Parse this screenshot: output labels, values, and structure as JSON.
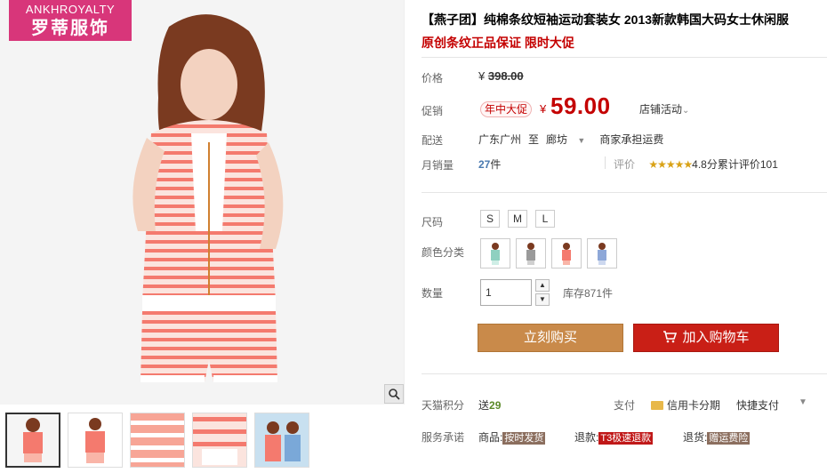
{
  "gallery": {
    "brand_en": "ANKHROYALTY",
    "brand_cn": "罗蒂服饰",
    "zoom_icon": "magnifier-icon",
    "thumbnail_count": 5
  },
  "product": {
    "title": "【燕子团】纯棉条纹短袖运动套装女 2013新款韩国大码女士休闲服",
    "subtitle": "原创条纹正品保证 限时大促"
  },
  "price": {
    "label": "价格",
    "currency": "¥",
    "original": "398.00"
  },
  "promo": {
    "label": "促销",
    "tag": "年中大促",
    "currency": "¥",
    "price": "59.00",
    "store_activity": "店铺活动"
  },
  "shipping": {
    "label": "配送",
    "from": "广东广州",
    "to_word": "至",
    "destination": "廊坊",
    "fee_note": "商家承担运费"
  },
  "sales": {
    "label": "月销量",
    "count": "27",
    "unit": "件",
    "rating_label": "评价",
    "stars": "★★★★★",
    "rating_score": "4.8分",
    "review_text": "累计评价101"
  },
  "options": {
    "size_label": "尺码",
    "sizes": [
      "S",
      "M",
      "L"
    ],
    "color_label": "颜色分类",
    "quantity_label": "数量",
    "quantity_value": "1",
    "stock": "库存871件"
  },
  "buttons": {
    "buy_now": "立刻购买",
    "add_to_cart": "加入购物车"
  },
  "footer": {
    "points_label": "天猫积分",
    "points_prefix": "送",
    "points_value": "29",
    "pay_label": "支付",
    "pay_card": "信用卡分期",
    "pay_quick": "快捷支付",
    "service_label": "服务承诺",
    "svc_goods_label": "商品:",
    "svc_goods_tag": "按时发货",
    "svc_refund_label": "退款:",
    "svc_refund_tag": "T3极速退款",
    "svc_return_label": "退货:",
    "svc_return_tag": "赠运费险"
  },
  "colors": {
    "brand_pink": "#d8367a",
    "price_red": "#c40000",
    "buy_button": "#c98a4a",
    "cart_button": "#c91f16",
    "stripe_coral": "#f47a6e"
  }
}
